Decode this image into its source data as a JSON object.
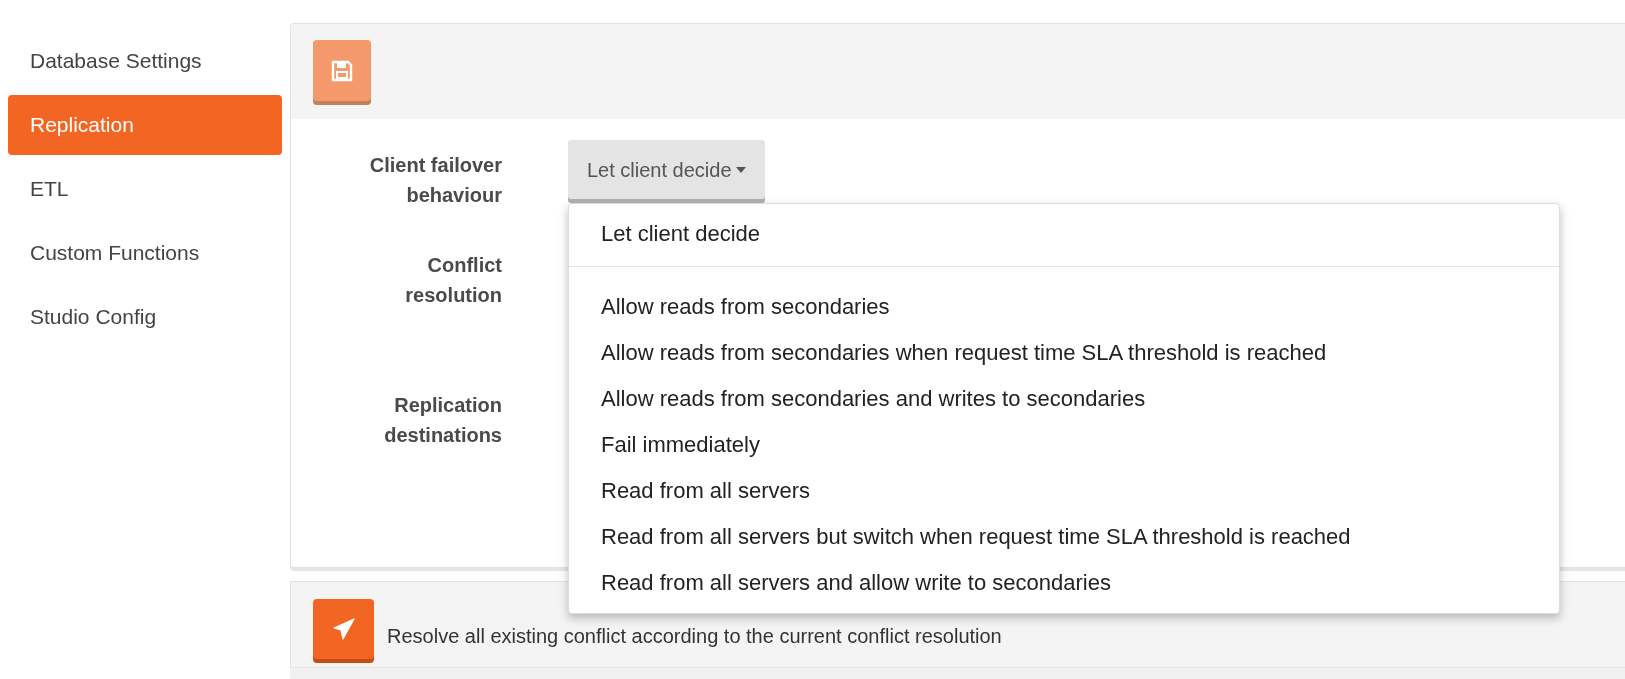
{
  "sidebar": {
    "items": [
      {
        "label": "Database Settings",
        "selected": false
      },
      {
        "label": "Replication",
        "selected": true
      },
      {
        "label": "ETL",
        "selected": false
      },
      {
        "label": "Custom Functions",
        "selected": false
      },
      {
        "label": "Studio Config",
        "selected": false
      }
    ]
  },
  "toolbar": {
    "save_button": {
      "disabled": true
    }
  },
  "form": {
    "fields": [
      {
        "label": "Client failover behaviour",
        "kind": "dropdown",
        "value": "Let client decide",
        "expanded": true
      },
      {
        "label": "Conflict resolution",
        "kind": "hidden"
      },
      {
        "label": "Replication destinations",
        "kind": "hidden"
      }
    ]
  },
  "dropdown_menu": {
    "items": [
      {
        "kind": "option",
        "label": "Let client decide"
      },
      {
        "kind": "divider"
      },
      {
        "kind": "option",
        "label": "Allow reads from secondaries"
      },
      {
        "kind": "option",
        "label": "Allow reads from secondaries when request time SLA threshold is reached"
      },
      {
        "kind": "option",
        "label": "Allow reads from secondaries and writes to secondaries"
      },
      {
        "kind": "option",
        "label": "Fail immediately"
      },
      {
        "kind": "option",
        "label": "Read from all servers"
      },
      {
        "kind": "option",
        "label": "Read from all servers but switch when request time SLA threshold is reached"
      },
      {
        "kind": "option",
        "label": "Read from all servers and allow write to secondaries"
      }
    ]
  },
  "resolve_panel": {
    "text": "Resolve all existing conflict according to the current conflict resolution"
  }
}
